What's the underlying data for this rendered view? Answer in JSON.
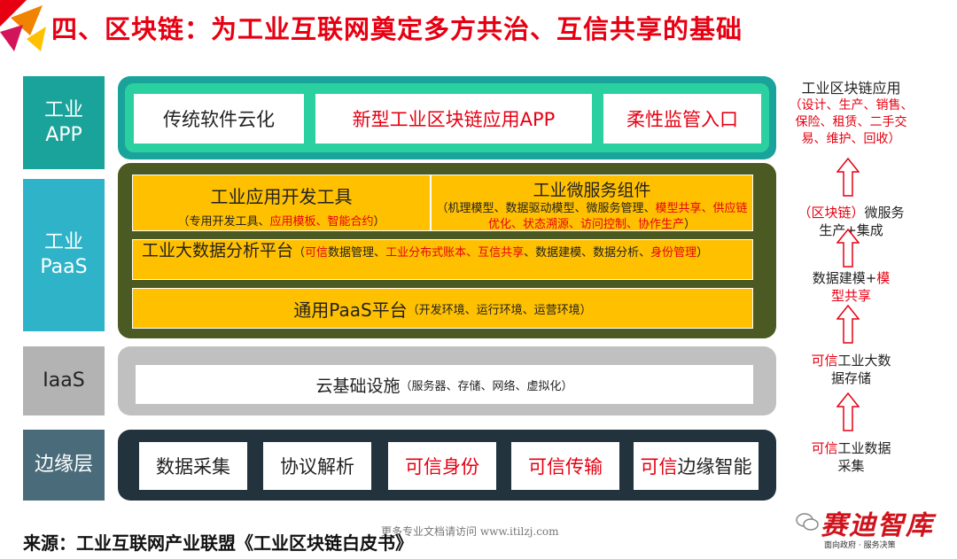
{
  "title": "四、区块链：为工业互联网奠定多方共治、互信共享的基础",
  "layers": {
    "app": {
      "label_line1": "工业",
      "label_line2": "APP",
      "color": "#1aa39a",
      "items": [
        "传统软件云化",
        "新型工业区块链应用APP",
        "柔性监管入口"
      ]
    },
    "paas": {
      "label_line1": "工业",
      "label_line2": "PaaS",
      "color": "#2fb3c8",
      "dev_tools": {
        "title": "工业应用开发工具",
        "paren_open": "（专用开发工具、",
        "red1": "应用模板、智能合约",
        "paren_close": "）"
      },
      "microservice": {
        "title": "工业微服务组件",
        "p1": "（机理模型、数据驱动模型、微服务管理、",
        "r1": "模型共享、供应链优化、状态溯源、访问控制、协作生产",
        "p2": "）"
      },
      "bigdata": {
        "title": "工业大数据分析平台",
        "paren_open": "（",
        "r1": "可信",
        "t1": "数据管理、",
        "r2": "工业分布式账本、互信共享",
        "t2": "、数据建模、数据分析、",
        "r3": "身份管理",
        "paren_close": "）"
      },
      "general": {
        "title": "通用PaaS平台",
        "detail": "（开发环境、运行环境、运营环境）"
      }
    },
    "iaas": {
      "label": "IaaS",
      "color": "#b3b3b3",
      "title": "云基础设施",
      "detail": "（服务器、存储、网络、虚拟化）"
    },
    "edge": {
      "label": "边缘层",
      "color": "#4a6b7a",
      "items": [
        {
          "text": "数据采集",
          "red": false
        },
        {
          "text": "协议解析",
          "red": false
        },
        {
          "text": "可信身份",
          "red": true
        },
        {
          "text": "可信传输",
          "red": true
        }
      ],
      "last": {
        "red": "可信",
        "black": "边缘智能"
      }
    }
  },
  "right_column": {
    "app_title": "工业区块链应用",
    "app_detail": "（设计、生产、销售、保险、租赁、二手交易、维护、回收）",
    "micro_red": "（区块链）",
    "micro_black1": "微服务",
    "micro_black2": "生产+集成",
    "model_black": "数据建模+",
    "model_red1": "模",
    "model_red2": "型共享",
    "bigdata_red": "可信",
    "bigdata_black1": "工业大数",
    "bigdata_black2": "据存储",
    "collect_red": "可信",
    "collect_black1": "工业数据",
    "collect_black2": "采集"
  },
  "watermark": "更多专业文档请访问 www.itilzj.com",
  "source": "来源：工业互联网产业联盟《工业区块链白皮书》",
  "brand": {
    "name": "赛迪智库",
    "slogan": "面向政府 · 服务决策"
  }
}
